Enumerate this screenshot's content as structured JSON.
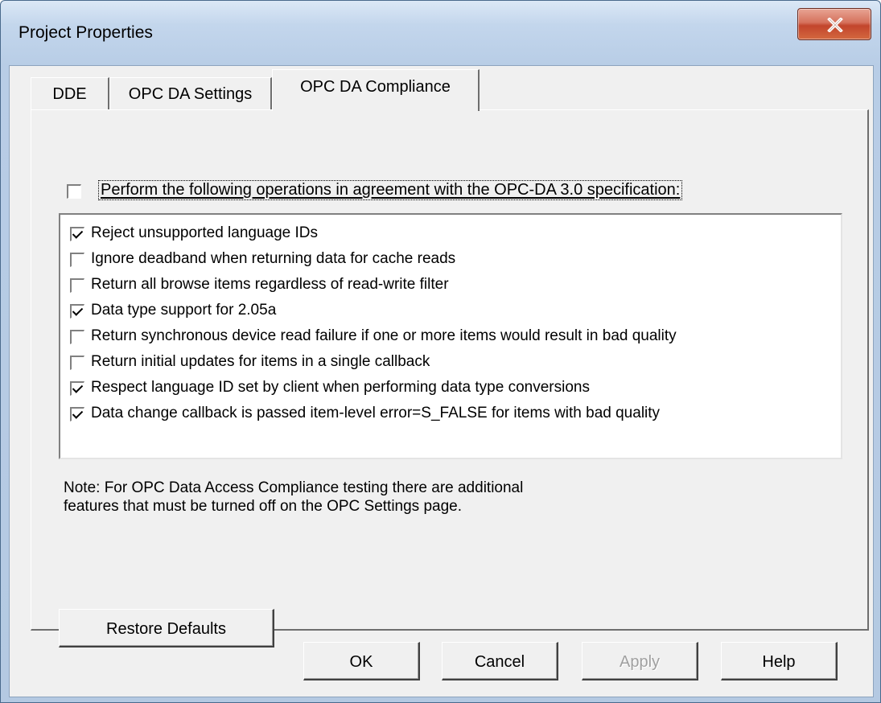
{
  "window": {
    "title": "Project Properties",
    "close_glyph": "✕"
  },
  "tabs": [
    {
      "label": "DDE",
      "active": false
    },
    {
      "label": "OPC DA Settings",
      "active": false
    },
    {
      "label": "OPC DA Compliance",
      "active": true
    }
  ],
  "compliance": {
    "main_option": {
      "label": "Perform the following operations in agreement with the OPC-DA 3.0 specification:",
      "checked": false
    },
    "items": [
      {
        "label": "Reject unsupported language IDs",
        "checked": true
      },
      {
        "label": "Ignore deadband when returning data for cache reads",
        "checked": false
      },
      {
        "label": "Return all browse items regardless of read-write filter",
        "checked": false
      },
      {
        "label": "Data type support for 2.05a",
        "checked": true
      },
      {
        "label": "Return synchronous device read failure if one or more items would result in bad quality",
        "checked": false
      },
      {
        "label": "Return initial updates for items in a single callback",
        "checked": false
      },
      {
        "label": "Respect language ID set by client when performing data type conversions",
        "checked": true
      },
      {
        "label": "Data change callback is passed item-level error=S_FALSE for items with bad quality",
        "checked": true
      }
    ],
    "note_line1": "Note: For OPC Data Access Compliance testing there are additional",
    "note_line2": "features that must be turned off on the OPC Settings page.",
    "restore_defaults_label": "Restore Defaults"
  },
  "footer": {
    "ok_label": "OK",
    "cancel_label": "Cancel",
    "apply_label": "Apply",
    "help_label": "Help"
  }
}
